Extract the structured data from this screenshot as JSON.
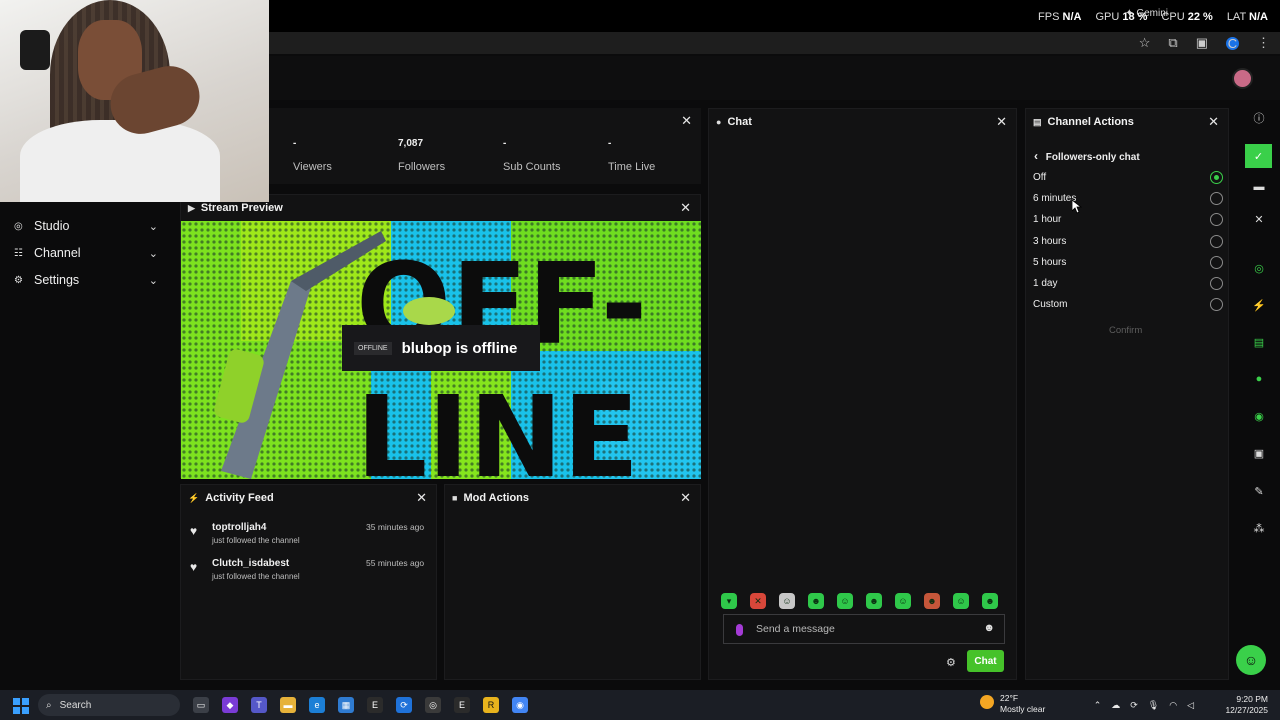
{
  "system_overlay": {
    "fps_label": "FPS",
    "fps_value": "N/A",
    "gpu_label": "GPU",
    "gpu_value": "18 %",
    "cpu_label": "CPU",
    "cpu_value": "22 %",
    "lat_label": "LAT",
    "lat_value": "N/A",
    "gemini": "Gemini"
  },
  "browser": {
    "profile_initial": "C"
  },
  "sidebar": {
    "items": [
      {
        "label": "Studio",
        "icon": "studio-icon"
      },
      {
        "label": "Channel",
        "icon": "channel-icon"
      },
      {
        "label": "Settings",
        "icon": "gear-icon"
      }
    ]
  },
  "stats": [
    {
      "value": "-",
      "label": "Viewers"
    },
    {
      "value": "7,087",
      "label": "Followers"
    },
    {
      "value": "-",
      "label": "Sub Counts"
    },
    {
      "value": "-",
      "label": "Time Live"
    }
  ],
  "stream_preview": {
    "title": "Stream Preview",
    "badge": "OFFLINE",
    "status": "blubop is offline",
    "art_line1": "OFF-",
    "art_line2": "LINE"
  },
  "activity_feed": {
    "title": "Activity Feed",
    "items": [
      {
        "user": "toptrolljah4",
        "action": "just followed the channel",
        "time": "35 minutes ago"
      },
      {
        "user": "Clutch_isdabest",
        "action": "just followed the channel",
        "time": "55 minutes ago"
      }
    ]
  },
  "mod_actions": {
    "title": "Mod Actions"
  },
  "chat": {
    "title": "Chat",
    "placeholder": "Send a message",
    "send_label": "Chat"
  },
  "channel_actions": {
    "title": "Channel Actions",
    "back_label": "Followers-only chat",
    "options": [
      {
        "label": "Off",
        "selected": true
      },
      {
        "label": "6 minutes",
        "selected": false
      },
      {
        "label": "1 hour",
        "selected": false
      },
      {
        "label": "3 hours",
        "selected": false
      },
      {
        "label": "5 hours",
        "selected": false
      },
      {
        "label": "1 day",
        "selected": false
      },
      {
        "label": "Custom",
        "selected": false
      }
    ],
    "confirm_label": "Confirm"
  },
  "taskbar": {
    "search_label": "Search",
    "weather_temp": "22°F",
    "weather_desc": "Mostly clear",
    "time": "9:20 PM",
    "date": "12/27/2025"
  },
  "colors": {
    "accent_green": "#3ad04a",
    "kick_green": "#53fc18"
  }
}
